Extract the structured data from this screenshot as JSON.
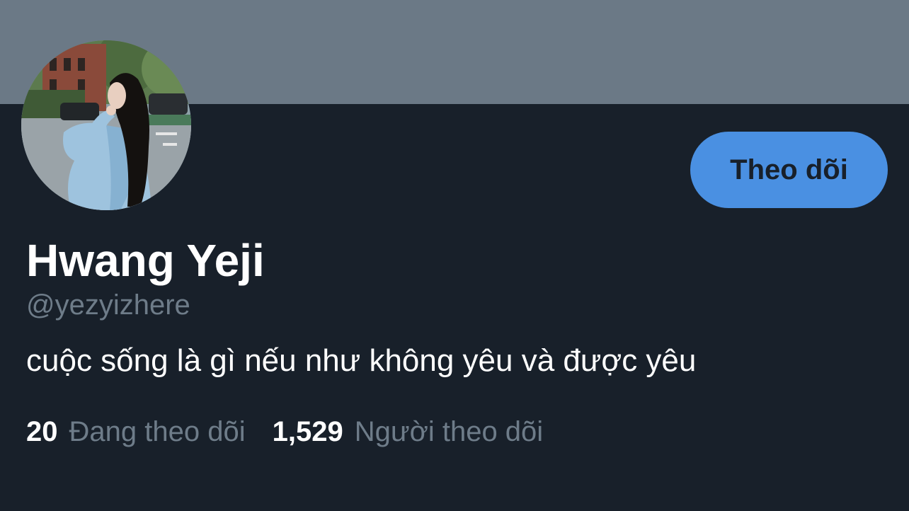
{
  "profile": {
    "display_name": "Hwang Yeji",
    "handle": "@yezyizhere",
    "bio": "cuộc sống là gì nếu như không yêu và được yêu",
    "avatar_icon": "profile-photo"
  },
  "actions": {
    "follow_label": "Theo dõi"
  },
  "stats": {
    "following_count": "20",
    "following_label": "Đang theo dõi",
    "followers_count": "1,529",
    "followers_label": "Người theo dõi"
  },
  "colors": {
    "background": "#18202a",
    "banner": "#6b7986",
    "accent": "#4a90e2",
    "muted_text": "#6e7c89"
  }
}
